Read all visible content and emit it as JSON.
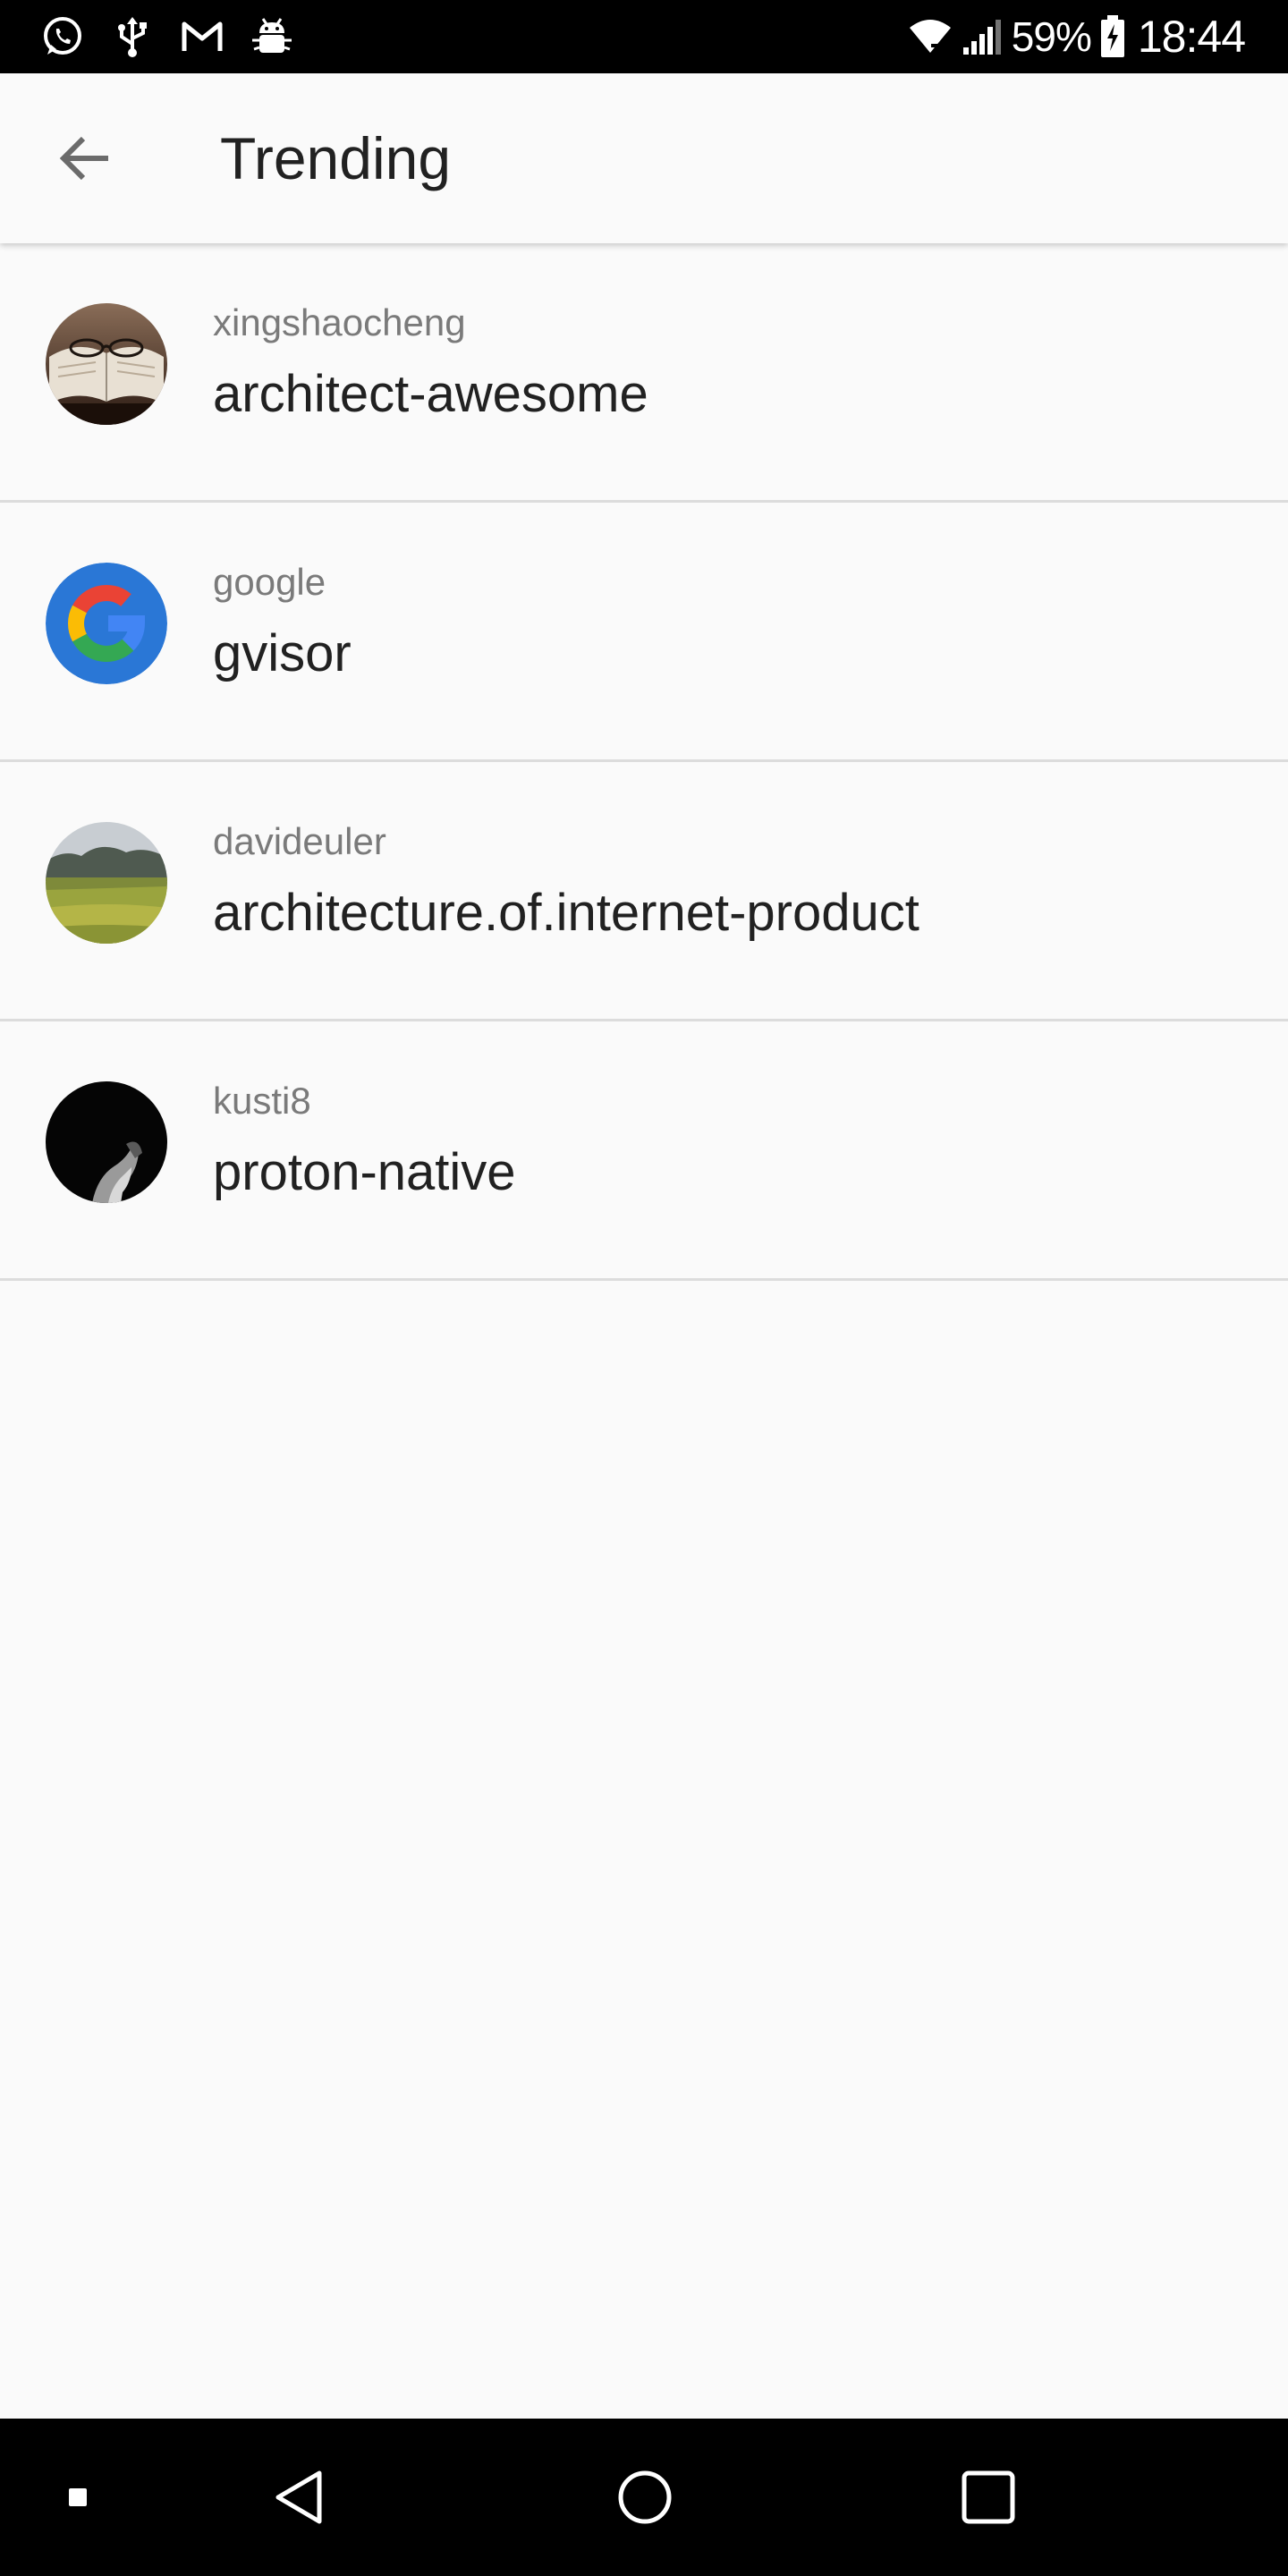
{
  "status_bar": {
    "battery_percent": "59%",
    "time": "18:44",
    "left_icons": [
      "whatsapp-icon",
      "usb-icon",
      "gmail-icon",
      "android-debug-icon"
    ],
    "right_icons": [
      "wifi-icon",
      "signal-icon",
      "battery-charging-icon"
    ]
  },
  "app_bar": {
    "title": "Trending",
    "back_icon": "arrow-back-icon"
  },
  "repos": [
    {
      "owner": "xingshaocheng",
      "name": "architect-awesome",
      "avatar": "book-glasses-photo"
    },
    {
      "owner": "google",
      "name": "gvisor",
      "avatar": "google-logo"
    },
    {
      "owner": "davideuler",
      "name": "architecture.of.internet-product",
      "avatar": "field-landscape-photo"
    },
    {
      "owner": "kusti8",
      "name": "proton-native",
      "avatar": "dark-portrait-photo"
    }
  ],
  "nav_bar": {
    "buttons": [
      "dot-icon",
      "back-triangle-icon",
      "home-circle-icon",
      "recents-square-icon"
    ]
  },
  "colors": {
    "background": "#fafafa",
    "title_text": "#212121",
    "secondary_text": "#7a7a7a",
    "divider": "#dcdcdc",
    "system_bars": "#000000"
  }
}
